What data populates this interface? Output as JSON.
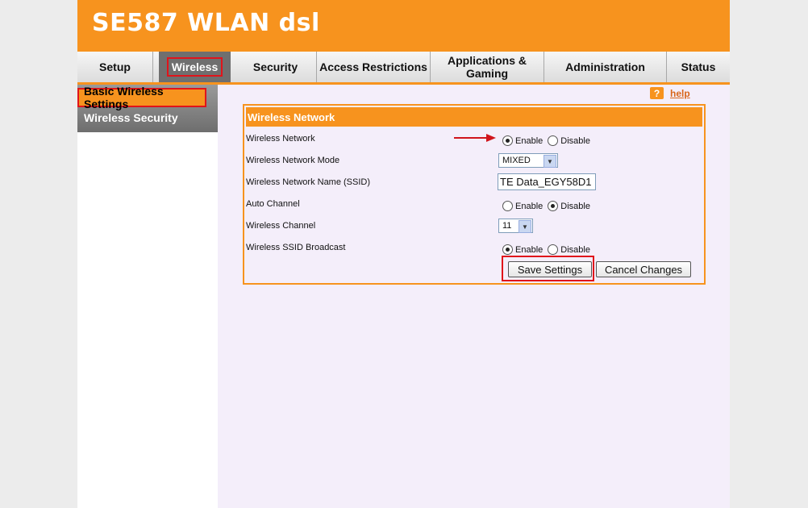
{
  "banner": {
    "title": "SE587 WLAN dsl"
  },
  "tabs": [
    {
      "label": "Setup"
    },
    {
      "label": "Wireless"
    },
    {
      "label": "Security"
    },
    {
      "label": "Access Restrictions"
    },
    {
      "label": "Applications & Gaming"
    },
    {
      "label": "Administration"
    },
    {
      "label": "Status"
    }
  ],
  "sidebar": {
    "items": [
      {
        "label": "Basic Wireless Settings"
      },
      {
        "label": "Wireless Security"
      }
    ]
  },
  "help": {
    "label": "help",
    "icon": "help-icon"
  },
  "panel": {
    "title": "Wireless Network",
    "rows": {
      "wireless_network": {
        "label": "Wireless Network",
        "enable": "Enable",
        "disable": "Disable",
        "selected": "Enable"
      },
      "mode": {
        "label": "Wireless Network Mode",
        "value": "MIXED"
      },
      "ssid": {
        "label": "Wireless Network Name (SSID)",
        "value": "TE Data_EGY58D1"
      },
      "auto_channel": {
        "label": "Auto Channel",
        "enable": "Enable",
        "disable": "Disable",
        "selected": "Disable"
      },
      "channel": {
        "label": "Wireless Channel",
        "value": "11"
      },
      "broadcast": {
        "label": "Wireless SSID Broadcast",
        "enable": "Enable",
        "disable": "Disable",
        "selected": "Enable"
      }
    },
    "save_label": "Save Settings",
    "cancel_label": "Cancel Changes"
  },
  "colors": {
    "brand": "#f7931e",
    "highlight": "#e0141b",
    "content_bg": "#f4eefa"
  }
}
